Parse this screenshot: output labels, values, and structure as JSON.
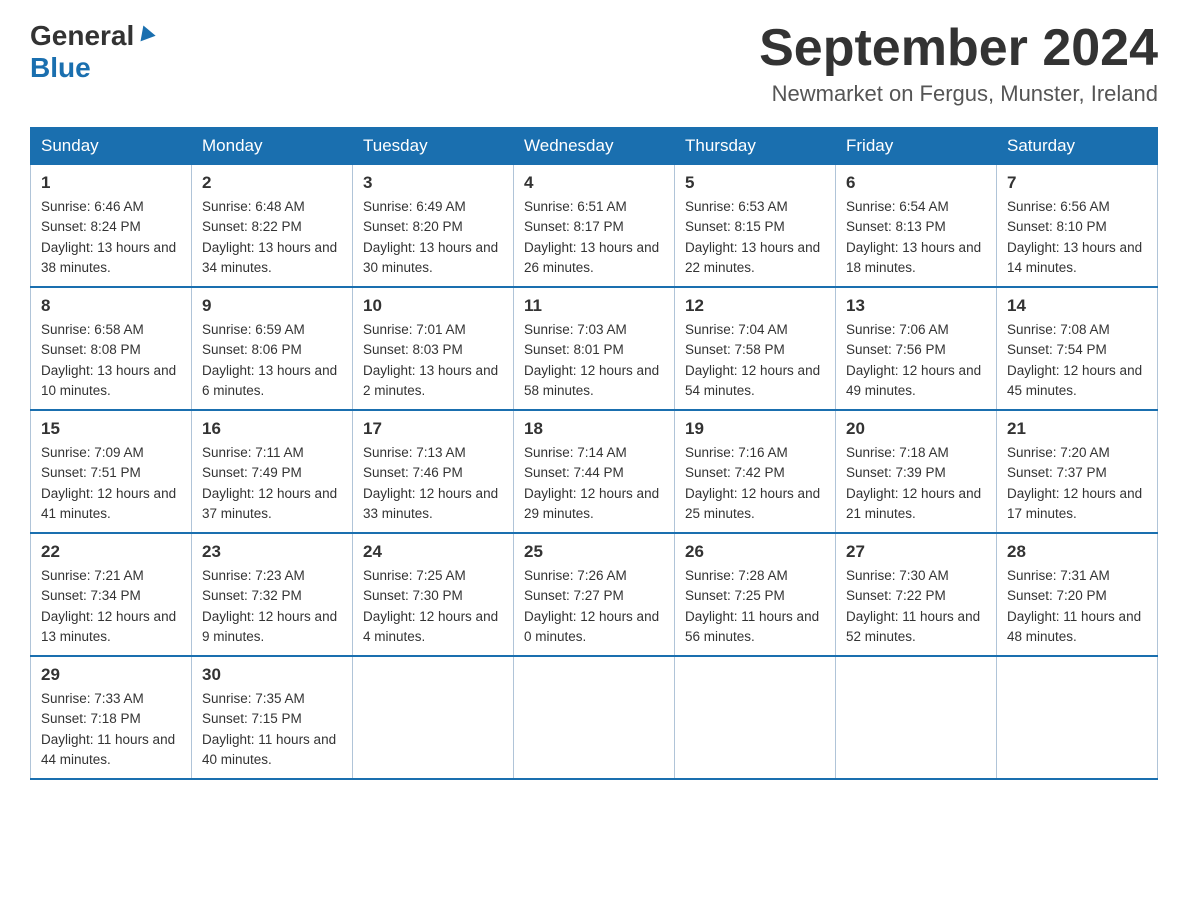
{
  "header": {
    "logo_general": "General",
    "logo_blue": "Blue",
    "month": "September 2024",
    "location": "Newmarket on Fergus, Munster, Ireland"
  },
  "days_of_week": [
    "Sunday",
    "Monday",
    "Tuesday",
    "Wednesday",
    "Thursday",
    "Friday",
    "Saturday"
  ],
  "weeks": [
    [
      {
        "day": "1",
        "sunrise": "6:46 AM",
        "sunset": "8:24 PM",
        "daylight": "13 hours and 38 minutes."
      },
      {
        "day": "2",
        "sunrise": "6:48 AM",
        "sunset": "8:22 PM",
        "daylight": "13 hours and 34 minutes."
      },
      {
        "day": "3",
        "sunrise": "6:49 AM",
        "sunset": "8:20 PM",
        "daylight": "13 hours and 30 minutes."
      },
      {
        "day": "4",
        "sunrise": "6:51 AM",
        "sunset": "8:17 PM",
        "daylight": "13 hours and 26 minutes."
      },
      {
        "day": "5",
        "sunrise": "6:53 AM",
        "sunset": "8:15 PM",
        "daylight": "13 hours and 22 minutes."
      },
      {
        "day": "6",
        "sunrise": "6:54 AM",
        "sunset": "8:13 PM",
        "daylight": "13 hours and 18 minutes."
      },
      {
        "day": "7",
        "sunrise": "6:56 AM",
        "sunset": "8:10 PM",
        "daylight": "13 hours and 14 minutes."
      }
    ],
    [
      {
        "day": "8",
        "sunrise": "6:58 AM",
        "sunset": "8:08 PM",
        "daylight": "13 hours and 10 minutes."
      },
      {
        "day": "9",
        "sunrise": "6:59 AM",
        "sunset": "8:06 PM",
        "daylight": "13 hours and 6 minutes."
      },
      {
        "day": "10",
        "sunrise": "7:01 AM",
        "sunset": "8:03 PM",
        "daylight": "13 hours and 2 minutes."
      },
      {
        "day": "11",
        "sunrise": "7:03 AM",
        "sunset": "8:01 PM",
        "daylight": "12 hours and 58 minutes."
      },
      {
        "day": "12",
        "sunrise": "7:04 AM",
        "sunset": "7:58 PM",
        "daylight": "12 hours and 54 minutes."
      },
      {
        "day": "13",
        "sunrise": "7:06 AM",
        "sunset": "7:56 PM",
        "daylight": "12 hours and 49 minutes."
      },
      {
        "day": "14",
        "sunrise": "7:08 AM",
        "sunset": "7:54 PM",
        "daylight": "12 hours and 45 minutes."
      }
    ],
    [
      {
        "day": "15",
        "sunrise": "7:09 AM",
        "sunset": "7:51 PM",
        "daylight": "12 hours and 41 minutes."
      },
      {
        "day": "16",
        "sunrise": "7:11 AM",
        "sunset": "7:49 PM",
        "daylight": "12 hours and 37 minutes."
      },
      {
        "day": "17",
        "sunrise": "7:13 AM",
        "sunset": "7:46 PM",
        "daylight": "12 hours and 33 minutes."
      },
      {
        "day": "18",
        "sunrise": "7:14 AM",
        "sunset": "7:44 PM",
        "daylight": "12 hours and 29 minutes."
      },
      {
        "day": "19",
        "sunrise": "7:16 AM",
        "sunset": "7:42 PM",
        "daylight": "12 hours and 25 minutes."
      },
      {
        "day": "20",
        "sunrise": "7:18 AM",
        "sunset": "7:39 PM",
        "daylight": "12 hours and 21 minutes."
      },
      {
        "day": "21",
        "sunrise": "7:20 AM",
        "sunset": "7:37 PM",
        "daylight": "12 hours and 17 minutes."
      }
    ],
    [
      {
        "day": "22",
        "sunrise": "7:21 AM",
        "sunset": "7:34 PM",
        "daylight": "12 hours and 13 minutes."
      },
      {
        "day": "23",
        "sunrise": "7:23 AM",
        "sunset": "7:32 PM",
        "daylight": "12 hours and 9 minutes."
      },
      {
        "day": "24",
        "sunrise": "7:25 AM",
        "sunset": "7:30 PM",
        "daylight": "12 hours and 4 minutes."
      },
      {
        "day": "25",
        "sunrise": "7:26 AM",
        "sunset": "7:27 PM",
        "daylight": "12 hours and 0 minutes."
      },
      {
        "day": "26",
        "sunrise": "7:28 AM",
        "sunset": "7:25 PM",
        "daylight": "11 hours and 56 minutes."
      },
      {
        "day": "27",
        "sunrise": "7:30 AM",
        "sunset": "7:22 PM",
        "daylight": "11 hours and 52 minutes."
      },
      {
        "day": "28",
        "sunrise": "7:31 AM",
        "sunset": "7:20 PM",
        "daylight": "11 hours and 48 minutes."
      }
    ],
    [
      {
        "day": "29",
        "sunrise": "7:33 AM",
        "sunset": "7:18 PM",
        "daylight": "11 hours and 44 minutes."
      },
      {
        "day": "30",
        "sunrise": "7:35 AM",
        "sunset": "7:15 PM",
        "daylight": "11 hours and 40 minutes."
      },
      null,
      null,
      null,
      null,
      null
    ]
  ],
  "labels": {
    "sunrise_prefix": "Sunrise: ",
    "sunset_prefix": "Sunset: ",
    "daylight_prefix": "Daylight: "
  }
}
